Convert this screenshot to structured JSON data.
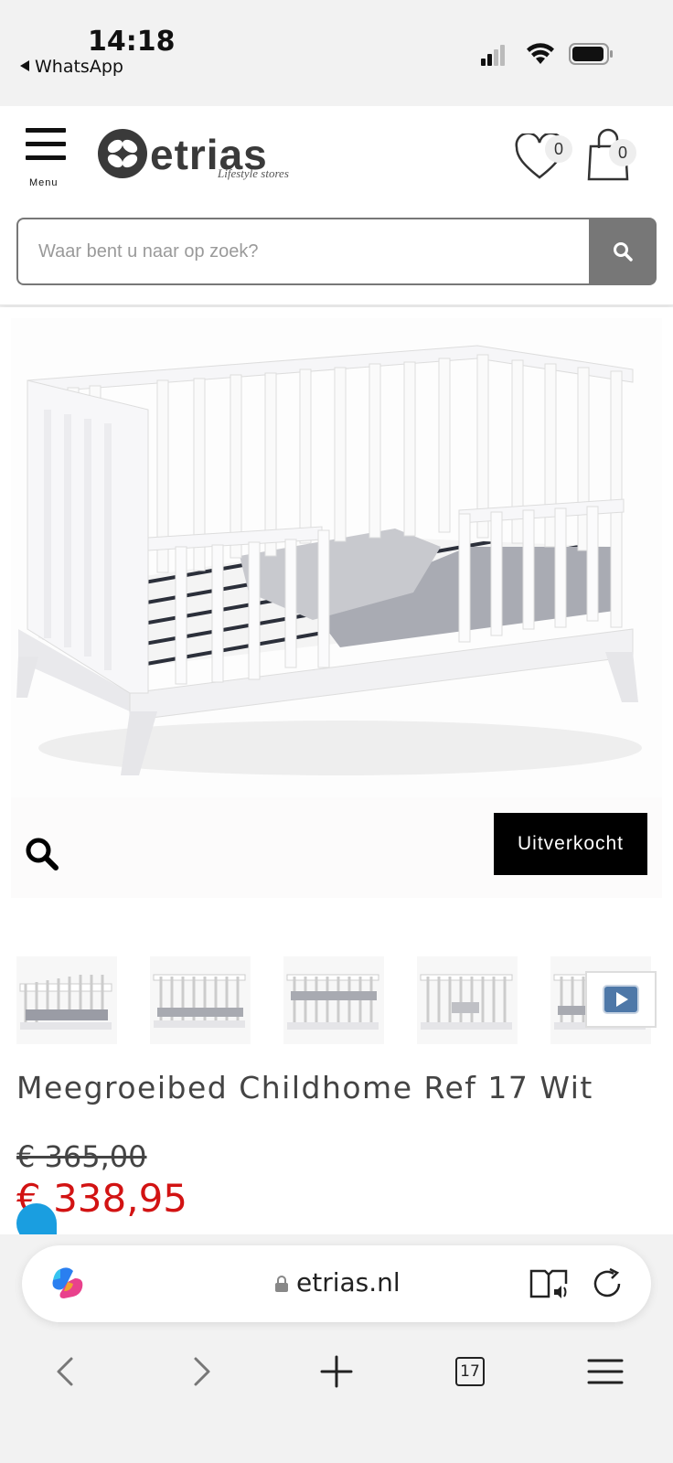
{
  "status_bar": {
    "time": "14:18",
    "back_app": "WhatsApp",
    "icons": [
      "cellular-signal-icon",
      "wifi-icon",
      "battery-icon"
    ]
  },
  "header": {
    "menu_label": "Menu",
    "logo_text": "etrias",
    "logo_subtitle": "Lifestyle stores",
    "wishlist_count": "0",
    "cart_count": "0"
  },
  "search": {
    "placeholder": "Waar bent u naar op zoek?"
  },
  "product": {
    "badge": "Uitverkocht",
    "title": "Meegroeibed Childhome Ref 17 Wit",
    "old_price": "€ 365,00",
    "price": "€ 338,95",
    "thumbnail_count": 5,
    "colors": {
      "price": "#d21313",
      "badge_bg": "#000000",
      "search_button": "#777777"
    }
  },
  "browser": {
    "url": "etrias.nl",
    "tab_count": "17",
    "icons": [
      "copilot-icon",
      "lock-icon",
      "reader-mode-icon",
      "reload-icon",
      "back-icon",
      "forward-icon",
      "new-tab-icon",
      "tabs-icon",
      "menu-icon"
    ]
  }
}
